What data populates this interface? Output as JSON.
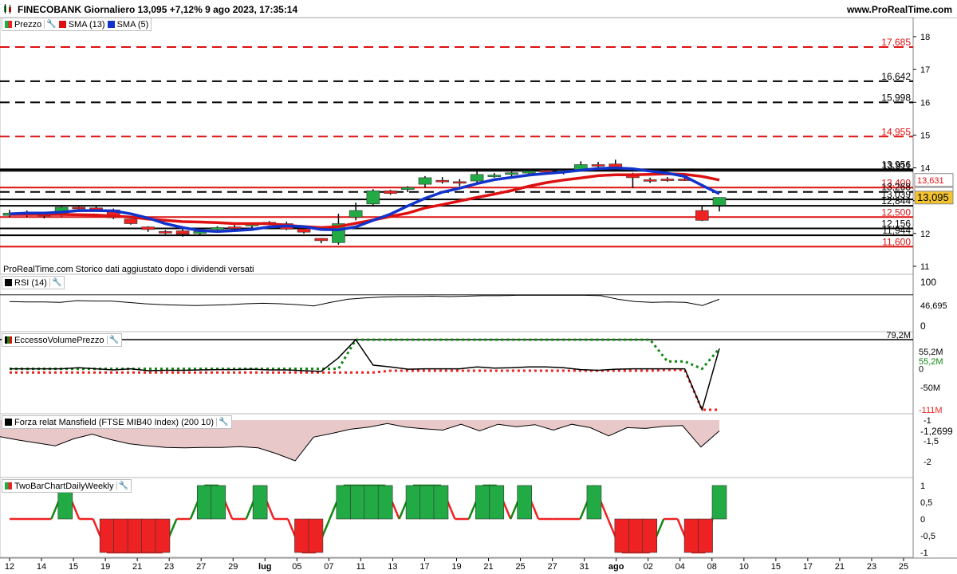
{
  "header": {
    "title": "FINECOBANK Giornaliero 13,095 +7,12% 9 ago 2023, 17:35:14",
    "site": "www.ProRealTime.com"
  },
  "colors": {
    "up": "#22aa44",
    "down": "#ee2222",
    "sma13": "#dd1111",
    "sma5": "#1133cc",
    "mansfield_fill": "#e8c8c8",
    "green_line": "#118811"
  },
  "legend": {
    "price": "Prezzo",
    "sma13": "SMA (13)",
    "sma5": "SMA (5)",
    "rsi": "RSI (14)",
    "volume": "EccessoVolumePrezzo",
    "mansfield": "Forza relat Mansfield (FTSE MIB40 Index) (200 10)",
    "twobar": "TwoBarChartDailyWeekly"
  },
  "notes": {
    "dividend": "ProRealTime.com Storico dati aggiustato dopo i dividendi versati"
  },
  "chart_data": {
    "type": "candlestick",
    "x_ticks": [
      "12",
      "14",
      "15",
      "19",
      "21",
      "23",
      "27",
      "29",
      "lug",
      "05",
      "07",
      "11",
      "13",
      "17",
      "19",
      "21",
      "25",
      "27",
      "31",
      "ago",
      "02",
      "04",
      "08",
      "10",
      "15",
      "17",
      "21",
      "23",
      "25"
    ],
    "y_ticks": [
      "18",
      "17",
      "16",
      "15",
      "14",
      "13",
      "12",
      "11"
    ],
    "current_price": "13,095",
    "sma13_value": "13,631",
    "sma5_value": "13,210",
    "levels": [
      {
        "value": 17.685,
        "label": "17,685",
        "color": "#dd1111",
        "style": "dash"
      },
      {
        "value": 16.642,
        "label": "16,642",
        "color": "#000000",
        "style": "dash"
      },
      {
        "value": 15.998,
        "label": "15,998",
        "color": "#000000",
        "style": "dash"
      },
      {
        "value": 14.955,
        "label": "14,955",
        "color": "#dd1111",
        "style": "dash"
      },
      {
        "value": 13.956,
        "label": "13,956",
        "color": "#000000",
        "style": "solid"
      },
      {
        "value": 13.911,
        "label": "13,911",
        "color": "#000000",
        "style": "solid"
      },
      {
        "value": 13.4,
        "label": "13,400",
        "color": "#dd1111",
        "style": "solid"
      },
      {
        "value": 13.268,
        "label": "13,268",
        "color": "#000000",
        "style": "dash"
      },
      {
        "value": 13.039,
        "label": "13,039",
        "color": "#000000",
        "style": "solid"
      },
      {
        "value": 12.844,
        "label": "12,844",
        "color": "#000000",
        "style": "solid"
      },
      {
        "value": 12.5,
        "label": "12,500",
        "color": "#dd1111",
        "style": "solid"
      },
      {
        "value": 12.156,
        "label": "12,156",
        "color": "#000000",
        "style": "solid"
      },
      {
        "value": 11.944,
        "label": "11,944",
        "color": "#000000",
        "style": "solid"
      },
      {
        "value": 11.6,
        "label": "11,600",
        "color": "#dd1111",
        "style": "solid"
      }
    ],
    "candles": [
      [
        12.55,
        12.72,
        12.5,
        12.62
      ],
      [
        12.62,
        12.7,
        12.5,
        12.58
      ],
      [
        12.58,
        12.62,
        12.46,
        12.55
      ],
      [
        12.55,
        12.85,
        12.52,
        12.8
      ],
      [
        12.8,
        12.82,
        12.7,
        12.78
      ],
      [
        12.78,
        12.83,
        12.7,
        12.76
      ],
      [
        12.72,
        12.76,
        12.44,
        12.48
      ],
      [
        12.44,
        12.45,
        12.27,
        12.3
      ],
      [
        12.2,
        12.22,
        12.05,
        12.12
      ],
      [
        12.06,
        12.1,
        11.98,
        12.04
      ],
      [
        12.08,
        12.16,
        11.9,
        11.98
      ],
      [
        12.0,
        12.12,
        11.96,
        12.06
      ],
      [
        12.12,
        12.22,
        12.06,
        12.18
      ],
      [
        12.2,
        12.26,
        12.13,
        12.18
      ],
      [
        12.24,
        12.32,
        12.18,
        12.28
      ],
      [
        12.3,
        12.38,
        12.25,
        12.34
      ],
      [
        12.3,
        12.36,
        12.1,
        12.13
      ],
      [
        12.14,
        12.17,
        12.0,
        12.04
      ],
      [
        11.85,
        11.86,
        11.7,
        11.78
      ],
      [
        11.72,
        12.6,
        11.66,
        12.3
      ],
      [
        12.5,
        12.94,
        12.4,
        12.7
      ],
      [
        12.9,
        13.35,
        12.82,
        13.3
      ],
      [
        13.3,
        13.33,
        13.18,
        13.22
      ],
      [
        13.34,
        13.44,
        13.26,
        13.4
      ],
      [
        13.5,
        13.75,
        13.4,
        13.7
      ],
      [
        13.62,
        13.72,
        13.52,
        13.58
      ],
      [
        13.58,
        13.66,
        13.44,
        13.54
      ],
      [
        13.6,
        13.95,
        13.56,
        13.8
      ],
      [
        13.78,
        13.84,
        13.7,
        13.78
      ],
      [
        13.82,
        13.88,
        13.72,
        13.85
      ],
      [
        13.84,
        13.92,
        13.78,
        13.9
      ],
      [
        13.92,
        13.96,
        13.86,
        13.9
      ],
      [
        13.88,
        13.96,
        13.8,
        13.92
      ],
      [
        13.95,
        14.2,
        13.9,
        14.1
      ],
      [
        14.1,
        14.18,
        14.02,
        14.08
      ],
      [
        14.12,
        14.25,
        13.9,
        13.96
      ],
      [
        13.82,
        13.85,
        13.38,
        13.7
      ],
      [
        13.64,
        13.7,
        13.54,
        13.62
      ],
      [
        13.66,
        13.72,
        13.58,
        13.64
      ],
      [
        13.66,
        13.72,
        13.6,
        13.64
      ],
      [
        12.7,
        12.82,
        12.38,
        12.4
      ],
      [
        12.86,
        13.1,
        12.67,
        13.1
      ]
    ],
    "sma13": [
      12.58,
      12.58,
      12.58,
      12.58,
      12.57,
      12.56,
      12.53,
      12.5,
      12.44,
      12.4,
      12.36,
      12.35,
      12.33,
      12.3,
      12.3,
      12.3,
      12.25,
      12.21,
      12.18,
      12.21,
      12.31,
      12.41,
      12.52,
      12.62,
      12.78,
      12.88,
      12.99,
      13.1,
      13.2,
      13.31,
      13.44,
      13.55,
      13.63,
      13.69,
      13.76,
      13.79,
      13.79,
      13.8,
      13.82,
      13.8,
      13.74,
      13.63
    ],
    "sma5": [
      12.6,
      12.62,
      12.62,
      12.65,
      12.7,
      12.7,
      12.69,
      12.6,
      12.47,
      12.3,
      12.18,
      12.09,
      12.06,
      12.09,
      12.12,
      12.2,
      12.23,
      12.21,
      12.12,
      12.11,
      12.2,
      12.4,
      12.59,
      12.84,
      13.07,
      13.26,
      13.38,
      13.52,
      13.64,
      13.71,
      13.78,
      13.83,
      13.87,
      13.93,
      13.98,
      14.0,
      13.97,
      13.9,
      13.84,
      13.74,
      13.47,
      13.21
    ],
    "rsi": {
      "label": "46,695",
      "ticks": [
        "100",
        "0"
      ],
      "values": [
        55,
        54,
        54,
        53,
        57,
        56,
        56,
        53,
        50,
        48,
        47,
        46,
        47,
        48,
        50,
        51,
        50,
        48,
        45,
        53,
        60,
        63,
        65,
        66,
        66,
        67,
        66,
        67,
        68,
        68,
        69,
        69,
        69,
        69,
        69,
        68,
        60,
        55,
        53,
        54,
        53,
        46,
        60
      ]
    },
    "excess_volume": {
      "ticks": [
        "79,2M",
        "55,2M",
        "0",
        "-50M",
        "-111M"
      ],
      "labels": [
        "55,2M",
        "55,2M",
        "0",
        "-111M"
      ],
      "black": [
        0,
        0,
        0,
        0,
        3,
        0,
        -3,
        0,
        -5,
        -4,
        -4,
        -3,
        -2,
        -2,
        -1,
        -3,
        -3,
        -5,
        -7,
        30,
        79,
        10,
        5,
        -1,
        0,
        0,
        0,
        5,
        2,
        3,
        5,
        5,
        3,
        -2,
        -4,
        -1,
        0,
        0,
        0,
        0,
        -111,
        55
      ],
      "green": [
        0,
        0,
        0,
        0,
        0,
        0,
        0,
        0,
        0,
        0,
        0,
        0,
        0,
        0,
        0,
        0,
        0,
        0,
        0,
        0,
        79,
        79,
        79,
        79,
        79,
        79,
        79,
        79,
        79,
        79,
        79,
        79,
        79,
        79,
        79,
        79,
        79,
        79,
        20,
        20,
        0,
        55
      ],
      "red": [
        -10,
        -10,
        -10,
        -10,
        -10,
        -10,
        -10,
        -10,
        -10,
        -10,
        -10,
        -10,
        -10,
        -10,
        -10,
        -10,
        -10,
        -10,
        -10,
        -10,
        -10,
        -10,
        -5,
        -5,
        -5,
        -5,
        -5,
        -5,
        -5,
        -5,
        -5,
        -5,
        -5,
        -5,
        -5,
        -5,
        -5,
        -5,
        -3,
        -3,
        -111,
        -111
      ]
    },
    "mansfield": {
      "label": "-1,2699",
      "ticks": [
        "-1",
        "-1,5",
        "-2"
      ],
      "values": [
        -1.4,
        -1.48,
        -1.55,
        -1.62,
        -1.45,
        -1.34,
        -1.47,
        -1.57,
        -1.62,
        -1.66,
        -1.67,
        -1.66,
        -1.66,
        -1.64,
        -1.67,
        -1.81,
        -1.98,
        -1.41,
        -1.32,
        -1.22,
        -1.17,
        -1.08,
        -1.17,
        -1.21,
        -1.24,
        -1.1,
        -1.26,
        -1.1,
        -1.16,
        -1.11,
        -1.24,
        -1.1,
        -1.18,
        -1.38,
        -1.18,
        -1.2,
        -1.15,
        -1.13,
        -1.65,
        -1.26
      ]
    },
    "twobar": {
      "ticks": [
        "1",
        "0,5",
        "0",
        "-0,5",
        "-1"
      ],
      "values": [
        0,
        0,
        0,
        0,
        1,
        0,
        0,
        -1,
        -1,
        -1,
        -1,
        -1,
        0,
        0,
        1,
        1,
        0,
        0,
        1,
        0,
        0,
        -1,
        -1,
        0,
        1,
        1,
        1,
        1,
        0,
        1,
        1,
        1,
        0,
        0,
        1,
        1,
        0,
        1,
        0,
        0,
        0,
        0,
        1,
        0,
        -1,
        -1,
        -1,
        0,
        0,
        -1,
        -1,
        1
      ]
    }
  }
}
